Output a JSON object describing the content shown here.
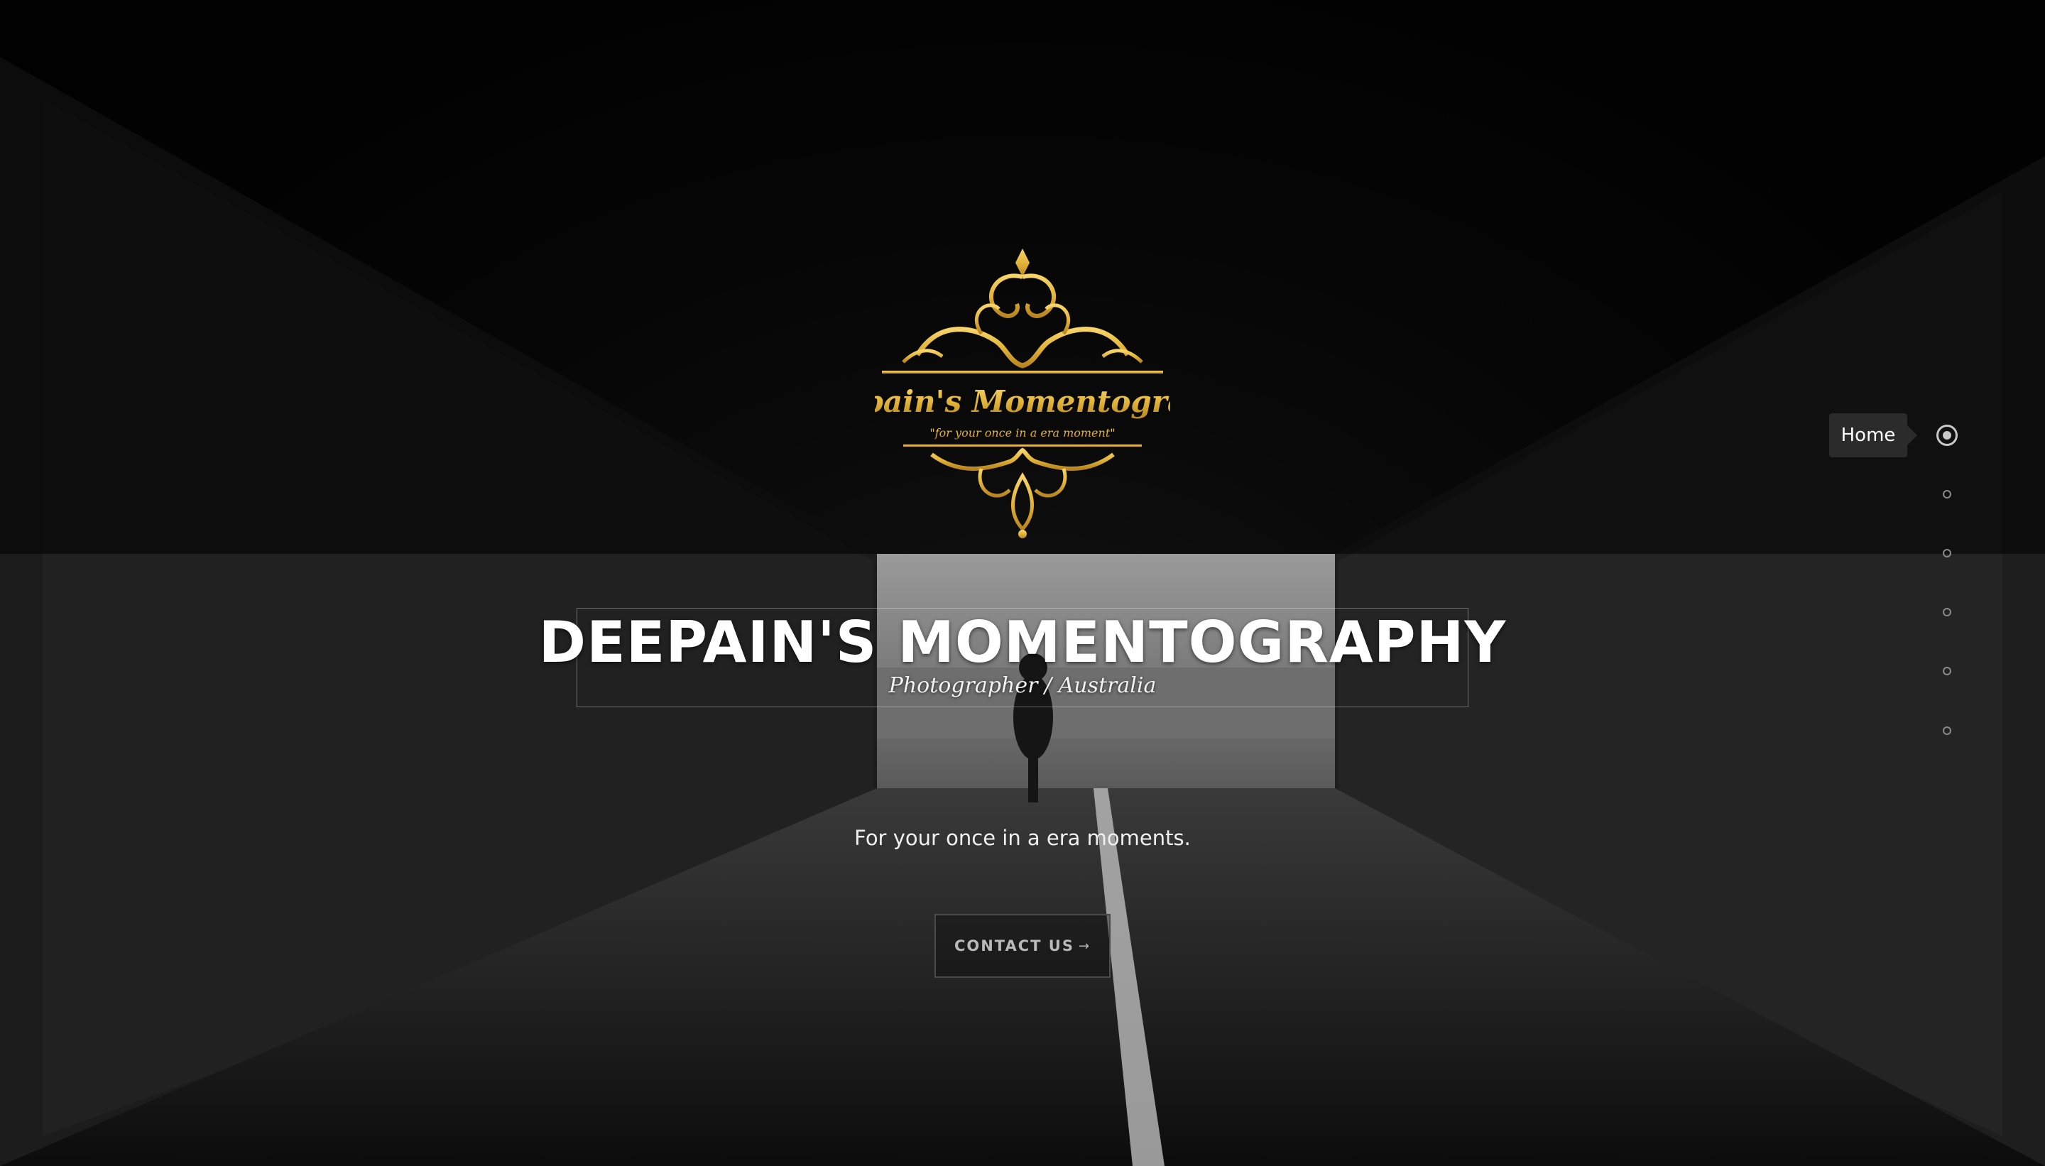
{
  "hero": {
    "logo": {
      "name_text": "Deepain's Momentography",
      "tagline_text": "\"for your once in a era moment\"",
      "icon": "ornamental-gold-crest-logo",
      "color": "#e3b53a"
    },
    "title": "DEEPAIN'S MOMENTOGRAPHY",
    "subtitle": "Photographer / Australia",
    "tagline": "For your once in a era moments.",
    "cta": {
      "label": "CONTACT US",
      "arrow": "→",
      "icon": "arrow-right-icon"
    }
  },
  "side_nav": {
    "active_label": "Home",
    "dots": [
      "Home",
      "",
      "",
      "",
      "",
      ""
    ]
  },
  "colors": {
    "accent_gold": "#e3b53a",
    "text": "#ffffff",
    "button_text": "#b9b9b9"
  }
}
